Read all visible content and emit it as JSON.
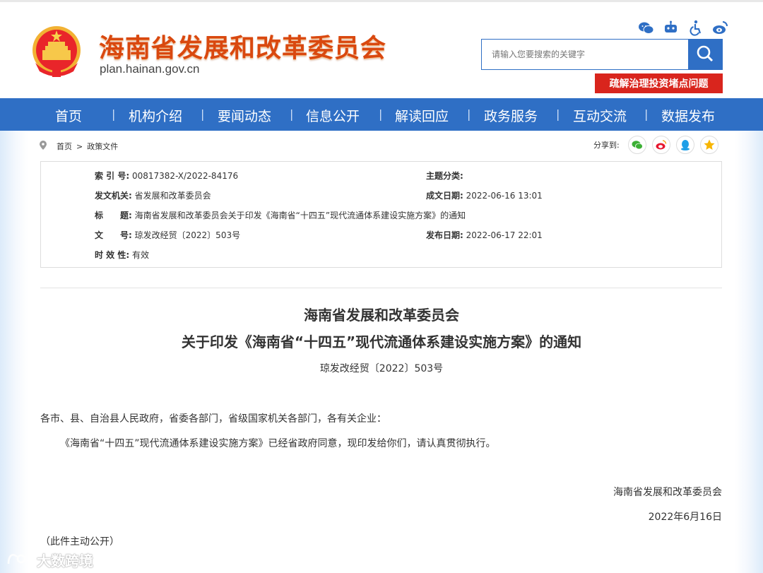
{
  "header": {
    "site_title": "海南省发展和改革委员会",
    "domain": "plan.hainan.gov.cn",
    "search_placeholder": "请输入您要搜索的关键字",
    "red_button": "疏解治理投资堵点问题",
    "top_icons": [
      "wechat-icon",
      "robot-icon",
      "accessibility-icon",
      "weibo-icon"
    ]
  },
  "nav": {
    "items": [
      "首页",
      "机构介绍",
      "要闻动态",
      "信息公开",
      "解读回应",
      "政务服务",
      "互动交流",
      "数据发布"
    ],
    "separator": "|"
  },
  "breadcrumb": {
    "home": "首页",
    "sep": ">",
    "current": "政策文件"
  },
  "share": {
    "label": "分享到:",
    "targets": [
      "wechat-icon",
      "weibo-icon",
      "qq-icon",
      "qzone-icon"
    ]
  },
  "meta": {
    "index_label": "索 引 号:",
    "index_value": "00817382-X/2022-84176",
    "topic_label": "主题分类:",
    "topic_value": "",
    "issuer_label": "发文机关:",
    "issuer_value": "省发展和改革委员会",
    "created_label": "成文日期:",
    "created_value": "2022-06-16 13:01",
    "title_label": "标　　题:",
    "title_value": "海南省发展和改革委员会关于印发《海南省“十四五”现代流通体系建设实施方案》的通知",
    "docno_label": "文　　号:",
    "docno_value": "琼发改经贸〔2022〕503号",
    "published_label": "发布日期:",
    "published_value": "2022-06-17 22:01",
    "validity_label": "时 效 性:",
    "validity_value": "有效"
  },
  "document": {
    "title_line1": "海南省发展和改革委员会",
    "title_line2": "关于印发《海南省“十四五”现代流通体系建设实施方案》的通知",
    "doc_number": "琼发改经贸〔2022〕503号",
    "salutation": "各市、县、自治县人民政府，省委各部门，省级国家机关各部门，各有关企业：",
    "body": "《海南省“十四五”现代流通体系建设实施方案》已经省政府同意，现印发给你们，请认真贯彻执行。",
    "signature": "海南省发展和改革委员会",
    "date": "2022年6月16日",
    "note": "（此件主动公开）"
  },
  "watermark": {
    "text": "大数跨境"
  },
  "colors": {
    "brand_blue": "#2f6fc5",
    "title_orange": "#d9480f",
    "alert_red": "#d9251d"
  }
}
